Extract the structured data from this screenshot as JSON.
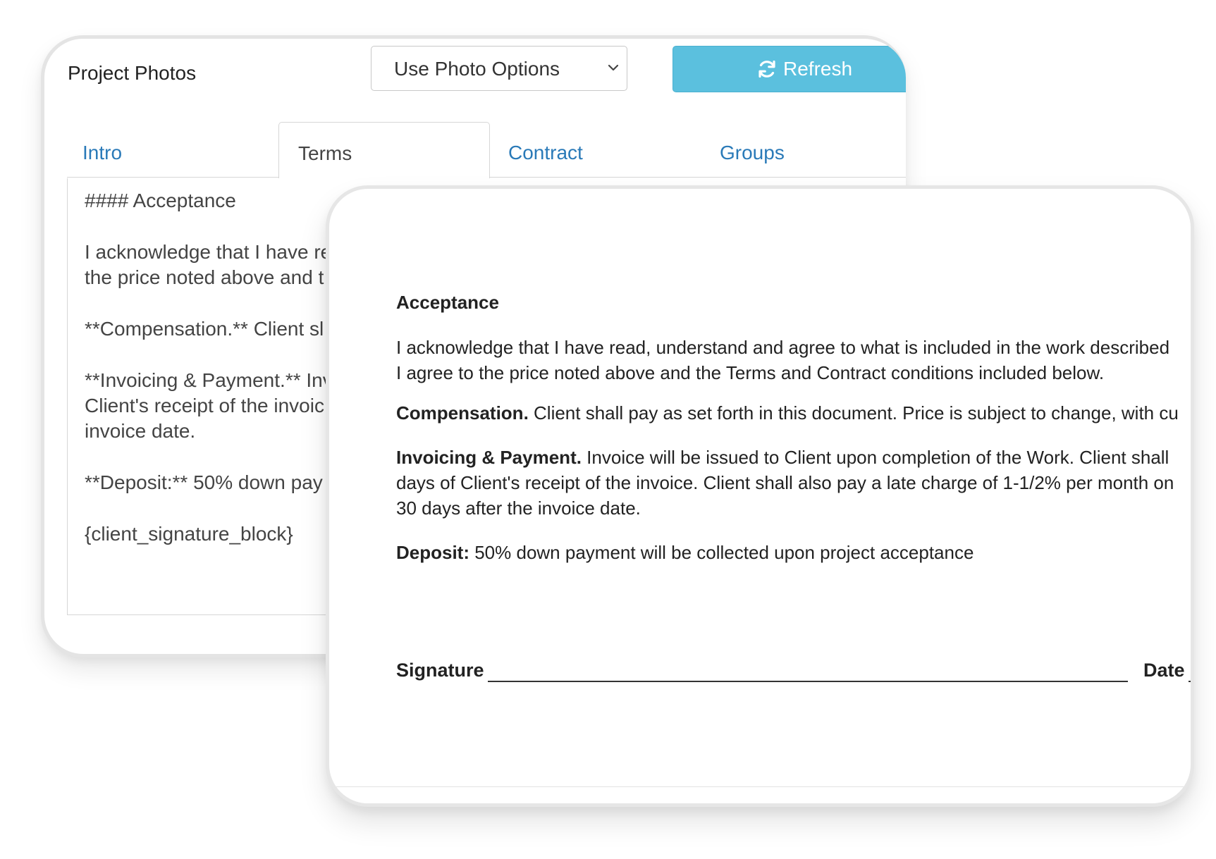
{
  "header": {
    "title": "Project Photos",
    "photo_select": {
      "value": "Use Photo Options",
      "icon": "chevron-down-icon"
    },
    "refresh": {
      "label": "Refresh",
      "icon": "refresh-icon",
      "color": "#5bc0de"
    }
  },
  "tabs": [
    {
      "label": "Intro",
      "active": false
    },
    {
      "label": "Terms",
      "active": true
    },
    {
      "label": "Contract",
      "active": false
    },
    {
      "label": "Groups",
      "active": false
    }
  ],
  "editor": {
    "lines": [
      "#### Acceptance",
      "I acknowledge that I have re",
      "the price noted above and t",
      "**Compensation.**  Client sl",
      "**Invoicing & Payment.** Inv",
      "Client's receipt of the invoic",
      "invoice date.",
      "**Deposit:** 50% down pay",
      "{client_signature_block}"
    ]
  },
  "preview": {
    "heading": "Acceptance",
    "acceptance_lines": [
      "I acknowledge that I have read, understand and agree to what is included in the work described",
      "I agree to the price noted above and the Terms and Contract conditions included below."
    ],
    "compensation": {
      "label": "Compensation.",
      "text": " Client shall pay as set forth in this document. Price is subject to change, with cu"
    },
    "invoicing": {
      "label": "Invoicing & Payment.",
      "text": " Invoice will be issued to Client upon completion of the Work. Client shall",
      "lines": [
        "days of Client's receipt of the invoice. Client shall also pay a late charge of 1-1/2% per month on",
        "30 days after the invoice date."
      ]
    },
    "deposit": {
      "label": "Deposit:",
      "text": " 50% down payment will be collected upon project acceptance"
    },
    "signature_label": "Signature",
    "date_label": "Date"
  }
}
